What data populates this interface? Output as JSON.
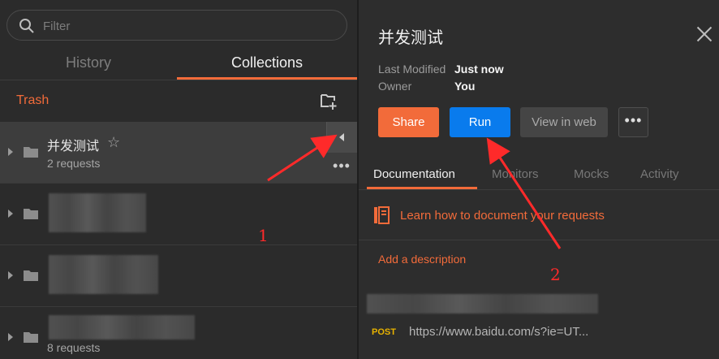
{
  "sidebar": {
    "search_placeholder": "Filter",
    "tabs": {
      "history": "History",
      "collections": "Collections"
    },
    "trash": "Trash",
    "collections": [
      {
        "name": "并发测试",
        "sub": "2 requests"
      },
      {
        "sub": "8 requests"
      }
    ]
  },
  "detail": {
    "title": "并发测试",
    "last_modified_label": "Last Modified",
    "last_modified_value": "Just now",
    "owner_label": "Owner",
    "owner_value": "You",
    "buttons": {
      "share": "Share",
      "run": "Run",
      "view_web": "View in web",
      "more": "•••"
    },
    "tabs": [
      "Documentation",
      "Monitors",
      "Mocks",
      "Activity"
    ],
    "learn_link": "Learn how to document your requests",
    "add_description": "Add a description",
    "request": {
      "method": "POST",
      "url": "https://www.baidu.com/s?ie=UT..."
    }
  },
  "annotations": {
    "label_1": "1",
    "label_2": "2"
  },
  "colors": {
    "accent": "#f26b3a",
    "run": "#097bed",
    "post": "#e8b300",
    "arrow": "#ff2a2a"
  }
}
